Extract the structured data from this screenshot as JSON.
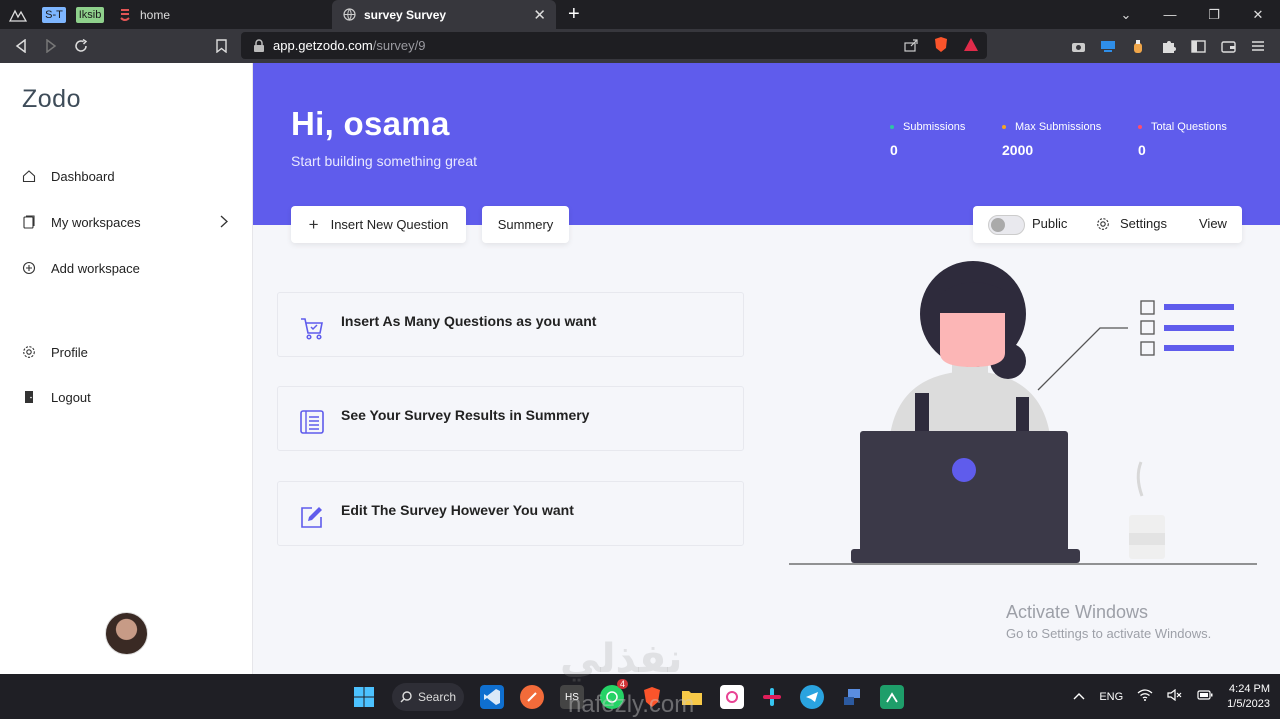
{
  "browser": {
    "pinned": [
      "S-T",
      "Iksib"
    ],
    "tabs": [
      {
        "title": "home",
        "active": false
      },
      {
        "title": "survey Survey",
        "active": true
      }
    ],
    "address": {
      "host": "app.getzodo.com",
      "path": "/survey/9"
    }
  },
  "sidebar": {
    "brand": "Zodo",
    "items": [
      {
        "label": "Dashboard",
        "icon": "home-icon"
      },
      {
        "label": "My workspaces",
        "icon": "folder-icon"
      },
      {
        "label": "Add workspace",
        "icon": "plus-circle-icon"
      },
      {
        "label": "Profile",
        "icon": "gear-icon"
      },
      {
        "label": "Logout",
        "icon": "door-icon"
      }
    ]
  },
  "hero": {
    "greeting": "Hi, osama",
    "subtitle": "Start building something great",
    "stats": [
      {
        "label": "Submissions",
        "value": "0",
        "color": "#2ec4a3"
      },
      {
        "label": "Max Submissions",
        "value": "2000",
        "color": "#f5a524"
      },
      {
        "label": "Total Questions",
        "value": "0",
        "color": "#ff4d6d"
      }
    ]
  },
  "actions": {
    "insert_question": "Insert New Question",
    "summery": "Summery",
    "public": "Public",
    "settings": "Settings",
    "view": "View"
  },
  "features": [
    {
      "text": "Insert As Many Questions as you want",
      "icon": "cart-icon"
    },
    {
      "text": "See Your Survey Results in Summery",
      "icon": "list-icon"
    },
    {
      "text": "Edit The Survey However You want",
      "icon": "edit-icon"
    }
  ],
  "watermark": {
    "line1": "Activate Windows",
    "line2": "Go to Settings to activate Windows."
  },
  "taskbar": {
    "search": "Search",
    "whatsapp_badge": "4",
    "lang": "ENG",
    "time": "4:24 PM",
    "date": "1/5/2023"
  },
  "overlay": {
    "arabic": "نفذلي",
    "latin": "nafezly.com"
  },
  "colors": {
    "primary": "#5f5cec",
    "sidebar_bg": "#ffffff"
  }
}
